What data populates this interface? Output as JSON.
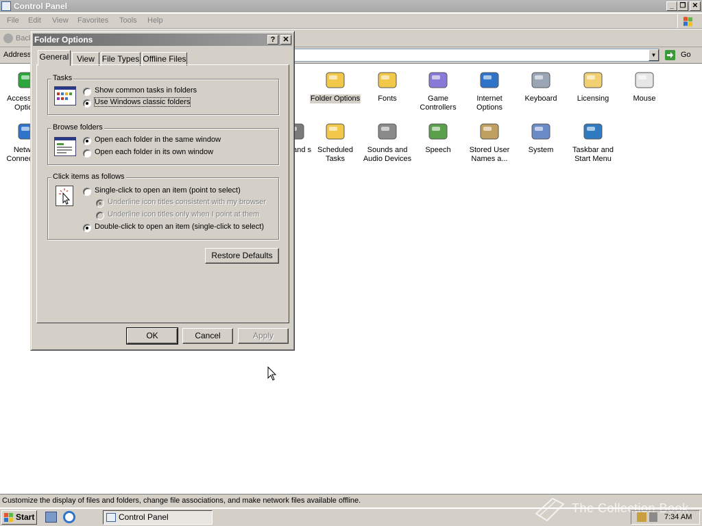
{
  "window": {
    "title": "Control Panel",
    "min_label": "_",
    "max_label": "❐",
    "close_label": "✕"
  },
  "menu": [
    "File",
    "Edit",
    "View",
    "Favorites",
    "Tools",
    "Help"
  ],
  "toolbar": {
    "back_label": "Back"
  },
  "address": {
    "label": "Address",
    "go_label": "Go"
  },
  "icons_row1": [
    {
      "name": "accessibility-options",
      "label": "Accessibility Options",
      "icon": "accessibility-icon",
      "color": "#2aa63a"
    },
    {
      "name": "folder-options",
      "label": "Folder Options",
      "icon": "folder-options-icon",
      "color": "#f2c84b",
      "selected": true
    },
    {
      "name": "fonts",
      "label": "Fonts",
      "icon": "fonts-folder-icon",
      "color": "#f2c84b"
    },
    {
      "name": "game-controllers",
      "label": "Game Controllers",
      "icon": "gamepad-icon",
      "color": "#8a7ad8"
    },
    {
      "name": "internet-options",
      "label": "Internet Options",
      "icon": "globe-icon",
      "color": "#2f74c8"
    },
    {
      "name": "keyboard",
      "label": "Keyboard",
      "icon": "keyboard-icon",
      "color": "#9aa6b6"
    },
    {
      "name": "licensing",
      "label": "Licensing",
      "icon": "certificate-icon",
      "color": "#f0d070"
    },
    {
      "name": "mouse",
      "label": "Mouse",
      "icon": "mouse-icon",
      "color": "#e6e6e6"
    }
  ],
  "icons_row2": [
    {
      "name": "network-connections",
      "label": "Network Connections",
      "icon": "network-globe-icon",
      "color": "#2f74c8"
    },
    {
      "name": "scanners-and-cameras",
      "label": "and s",
      "icon": "camera-icon",
      "color": "#7a7a7a"
    },
    {
      "name": "scheduled-tasks",
      "label": "Scheduled Tasks",
      "icon": "scheduled-tasks-icon",
      "color": "#f2c84b"
    },
    {
      "name": "sounds-and-audio",
      "label": "Sounds and Audio Devices",
      "icon": "speaker-icon",
      "color": "#8a8a8a"
    },
    {
      "name": "speech",
      "label": "Speech",
      "icon": "speech-icon",
      "color": "#5aa04a"
    },
    {
      "name": "stored-user-names",
      "label": "Stored User Names a...",
      "icon": "keys-icon",
      "color": "#c0a060"
    },
    {
      "name": "system",
      "label": "System",
      "icon": "computer-icon",
      "color": "#6a8ac8"
    },
    {
      "name": "taskbar-start-menu",
      "label": "Taskbar and Start Menu",
      "icon": "taskbar-icon",
      "color": "#2f7ac0"
    }
  ],
  "status": "Customize the display of files and folders, change file associations, and make network files available offline.",
  "taskbar": {
    "start_label": "Start",
    "task_label": "Control Panel",
    "time": "7:34 AM",
    "watermark": "The Collection Book"
  },
  "dialog": {
    "title": "Folder Options",
    "help_label": "?",
    "close_label": "✕",
    "tabs": [
      "General",
      "View",
      "File Types",
      "Offline Files"
    ],
    "tasks": {
      "title": "Tasks",
      "options": [
        "Show common tasks in folders",
        "Use Windows classic folders"
      ],
      "selected": 1
    },
    "browse": {
      "title": "Browse folders",
      "options": [
        "Open each folder in the same window",
        "Open each folder in its own window"
      ],
      "selected": 0
    },
    "click": {
      "title": "Click items as follows",
      "single": "Single-click to open an item (point to select)",
      "sub_options": [
        "Underline icon titles consistent with my browser",
        "Underline icon titles only when I point at them"
      ],
      "double": "Double-click to open an item (single-click to select)",
      "selected": "double"
    },
    "restore_label": "Restore Defaults",
    "ok_label": "OK",
    "cancel_label": "Cancel",
    "apply_label": "Apply"
  }
}
